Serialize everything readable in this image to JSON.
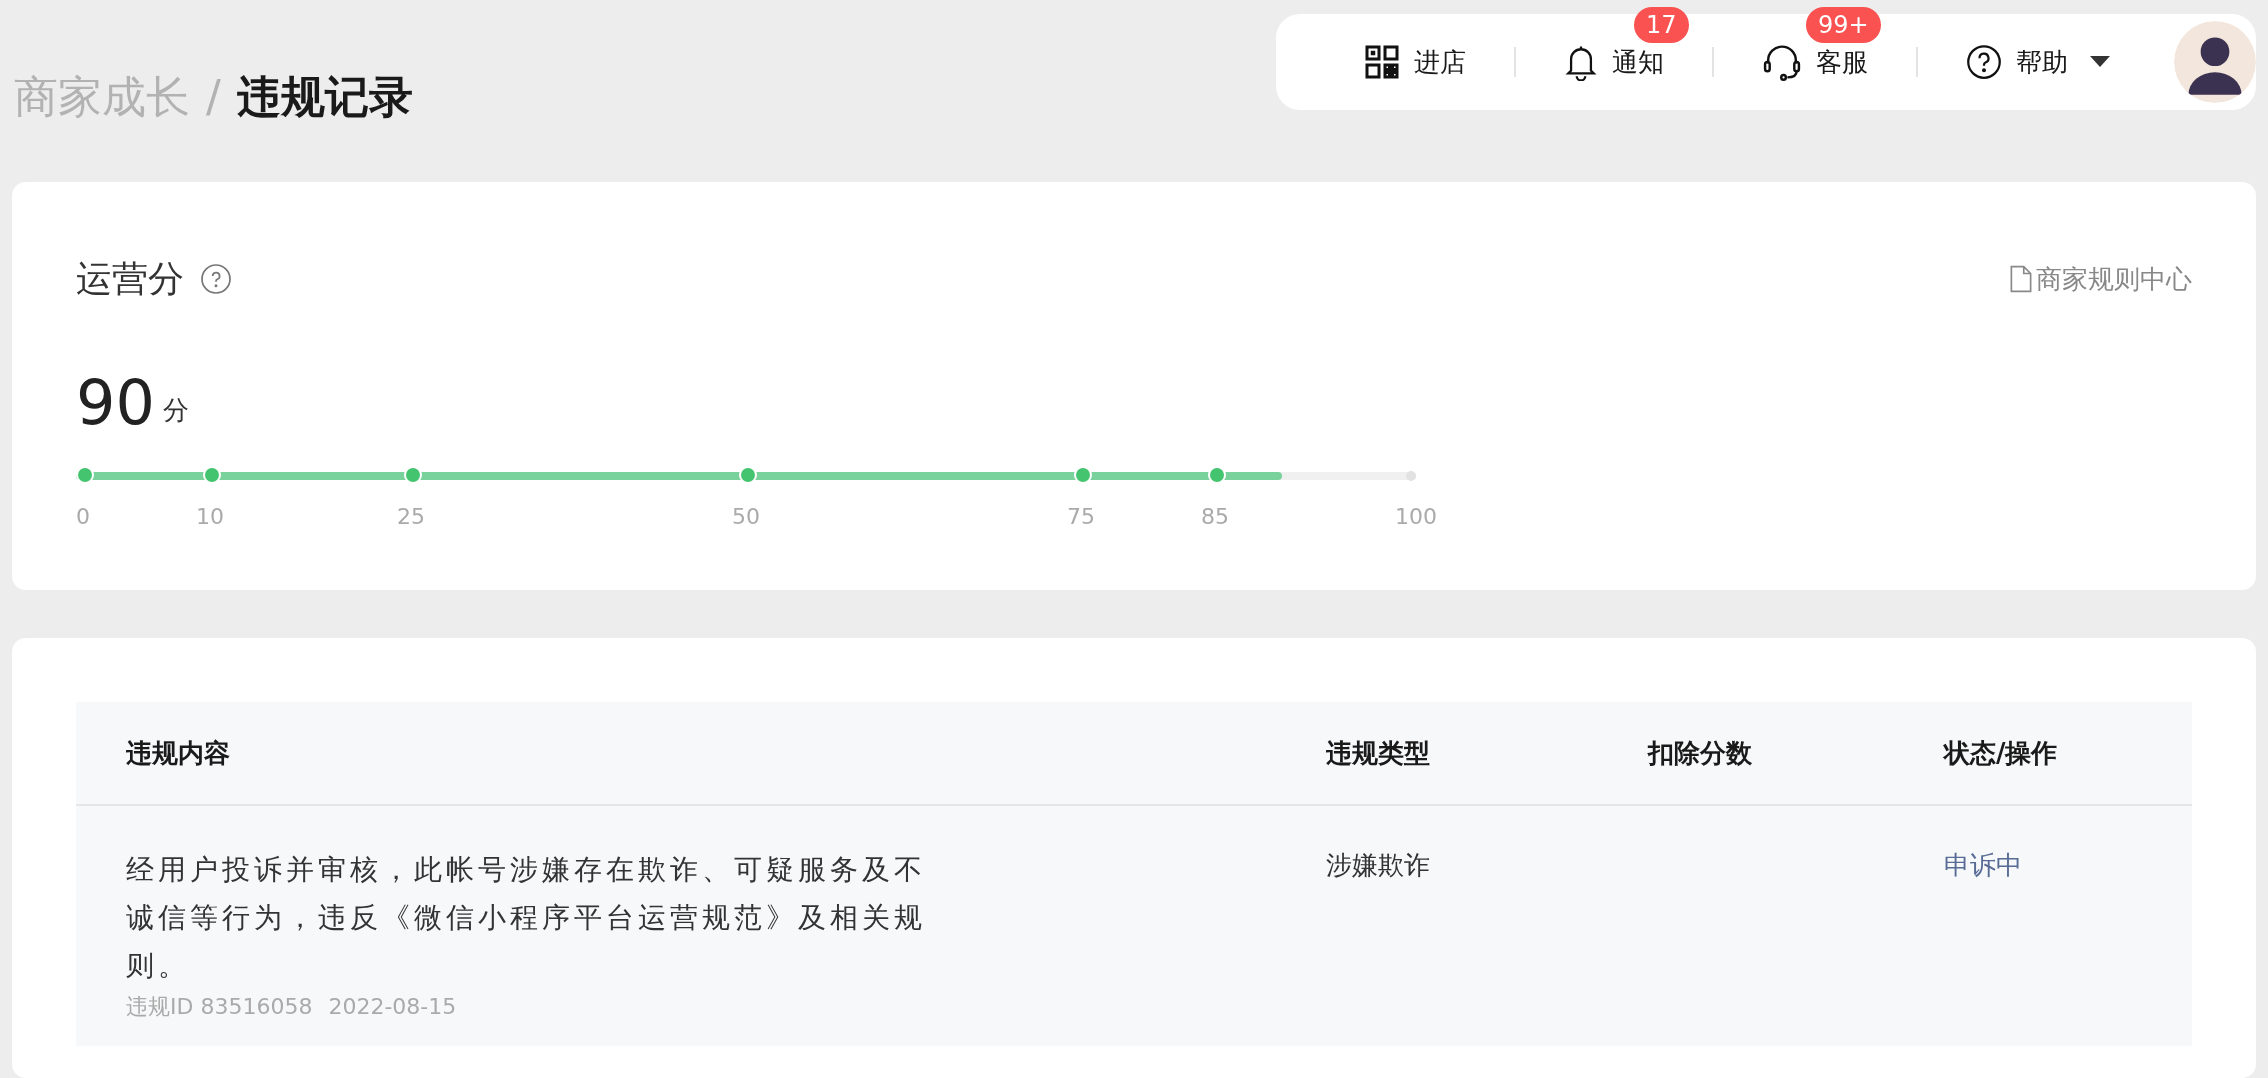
{
  "breadcrumb": {
    "parent": "商家成长",
    "separator": "/",
    "current": "违规记录"
  },
  "top_bar": {
    "items": [
      {
        "kind": "store",
        "label": "进店"
      },
      {
        "kind": "notice",
        "label": "通知",
        "badge": "17"
      },
      {
        "kind": "service",
        "label": "客服",
        "badge": "99+"
      },
      {
        "kind": "help",
        "label": "帮助",
        "dropdown": true
      }
    ]
  },
  "score_card": {
    "title": "运营分",
    "rules_link": "商家规则中心",
    "score": "90",
    "unit": "分",
    "level": 0.9,
    "ticks": [
      {
        "label": "0",
        "level": 0
      },
      {
        "label": "10",
        "level": 0.1
      },
      {
        "label": "25",
        "level": 0.25
      },
      {
        "label": "50",
        "level": 0.5
      },
      {
        "label": "75",
        "level": 0.75
      },
      {
        "label": "85",
        "level": 0.85
      },
      {
        "label": "100",
        "level": 1
      }
    ]
  },
  "table": {
    "columns": [
      "违规内容",
      "违规类型",
      "扣除分数",
      "状态/操作"
    ],
    "rows": [
      {
        "content": "经用户投诉并审核，此帐号涉嫌存在欺诈、可疑服务及不诚信等行为，违反《微信小程序平台运营规范》及相关规则。",
        "meta_id": "违规ID 83516058",
        "meta_date": "2022-08-15",
        "type": "涉嫌欺诈",
        "status": "申诉中"
      }
    ]
  }
}
